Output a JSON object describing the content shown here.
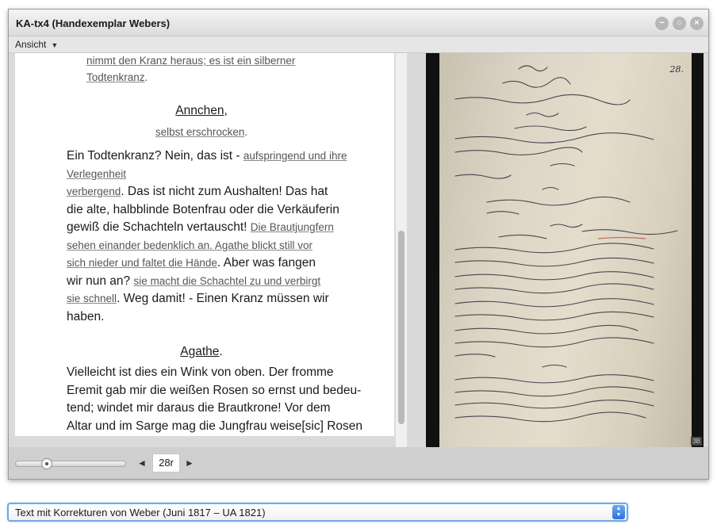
{
  "window": {
    "title": "KA-tx4 (Handexemplar Webers)",
    "buttons": {
      "minimize": "−",
      "restore": "○",
      "close": "×"
    }
  },
  "menu": {
    "ansicht": "Ansicht",
    "caret": "▼"
  },
  "text": {
    "frag1": "nimmt den Kranz heraus; es ist ein silberner",
    "frag2": "Todtenkranz",
    "frag2_end": ".",
    "speaker1": "Annchen,",
    "dir1": "selbst erschrocken",
    "dir1_end": ".",
    "l1a": "Ein Todtenkranz? Nein, das ist - ",
    "l1b": "aufspringend und ihre",
    "l2": "Verlegenheit",
    "l3a": "verbergend",
    "l3b": ". Das ist nicht zum Aushalten! Das hat",
    "l4": "die alte, halbblinde Botenfrau oder die Verkäuferin",
    "l5a": "gewiß die Schachteln vertauscht! ",
    "l5b": "Die Brautjungfern",
    "l6": "sehen einander bedenklich an. Agathe blickt still vor",
    "l7a": "sich nieder und faltet die Hände",
    "l7b": ". Aber was fangen",
    "l8a": "wir nun an? ",
    "l8b": "sie macht die Schachtel zu und verbirgt",
    "l9a": "sie schnell",
    "l9b": ". Weg damit! - Einen Kranz müssen wir",
    "l10": "haben.",
    "speaker2": "Agathe",
    "speaker2_end": ".",
    "m1": "Vielleicht ist dies ein Wink von oben. Der fromme",
    "m2": "Eremit gab mir die weißen Rosen so ernst und bedeu-",
    "m3": "tend; windet mir daraus die Brautkrone! Vor dem",
    "m4": "Altar und im Sarge mag die Jungfrau weise[sic] Rosen"
  },
  "image": {
    "page_mark": "28.",
    "tag": "3B"
  },
  "bottom": {
    "prev": "◄",
    "next": "►",
    "page": "28r",
    "zoom_level": 0.25
  },
  "version_select": {
    "selected": "Text mit Korrekturen von Weber (Juni 1817 – UA 1821)"
  }
}
